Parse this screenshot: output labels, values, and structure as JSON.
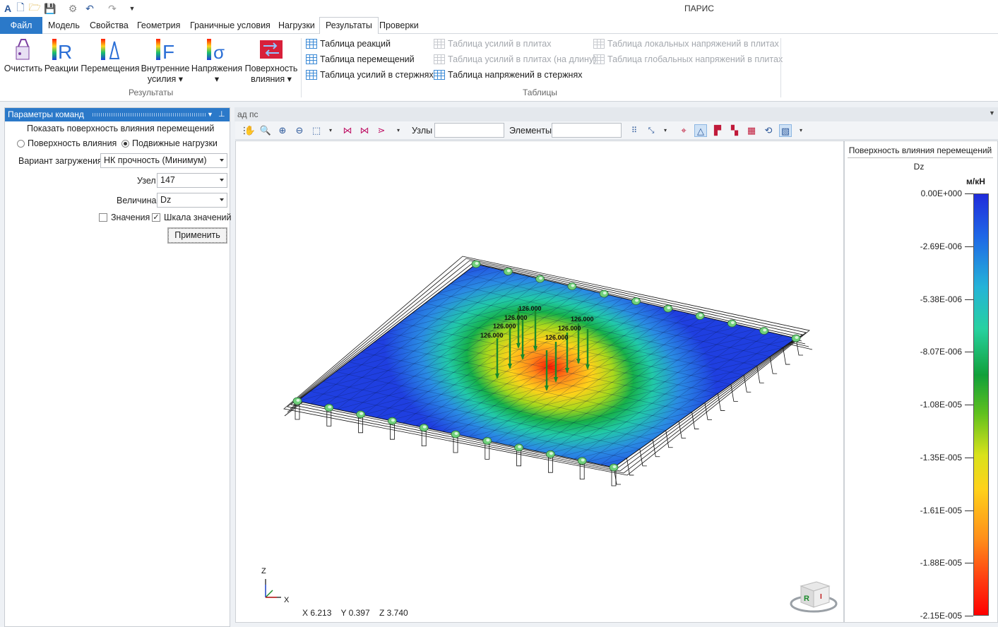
{
  "app": {
    "title": "ПАРИС"
  },
  "menu": {
    "tabs": [
      "Файл",
      "Модель",
      "Свойства",
      "Геометрия",
      "Граничные условия",
      "Нагрузки",
      "Результаты",
      "Проверки"
    ],
    "active": "Результаты"
  },
  "ribbon": {
    "results_group": {
      "label": "Результаты",
      "buttons": [
        {
          "label": "Очистить"
        },
        {
          "label": "Реакции"
        },
        {
          "label": "Перемещения"
        },
        {
          "label": "Внутренние",
          "label2": "усилия ▾"
        },
        {
          "label": "Напряжения",
          "label2": "▾"
        },
        {
          "label": "Поверхность",
          "label2": "влияния ▾"
        }
      ]
    },
    "tables_group": {
      "label": "Таблицы",
      "items": [
        {
          "label": "Таблица реакций",
          "enabled": true
        },
        {
          "label": "Таблица перемещений",
          "enabled": true
        },
        {
          "label": "Таблица усилий в стержнях",
          "enabled": true
        },
        {
          "label": "Таблица усилий в плитах",
          "enabled": false
        },
        {
          "label": "Таблица усилий в плитах (на длину)",
          "enabled": false
        },
        {
          "label": "Таблица напряжений в стержнях",
          "enabled": true
        },
        {
          "label": "Таблица локальных напряжений в плитах",
          "enabled": false
        },
        {
          "label": "Таблица глобальных напряжений в плитах",
          "enabled": false
        }
      ]
    }
  },
  "panel": {
    "title": "Параметры команд",
    "heading": "Показать поверхность влияния перемещений",
    "radio1": "Поверхность влияния",
    "radio2": "Подвижные нагрузки",
    "radio_selected": "Подвижные нагрузки",
    "variant_label": "Вариант загружения",
    "variant_value": "НК прочность (Минимум)",
    "node_label": "Узел",
    "node_value": "147",
    "quantity_label": "Величина",
    "quantity_value": "Dz",
    "values_label": "Значения",
    "values_checked": false,
    "scale_label": "Шкала значений",
    "scale_checked": true,
    "apply": "Применить"
  },
  "viewport": {
    "tab": "ад пс",
    "nodes_label": "Узлы",
    "elements_label": "Элементы",
    "load_labels": [
      "126.000",
      "126.000",
      "126.000",
      "126.000",
      "126.000",
      "126.000",
      "126.000"
    ],
    "axes": {
      "z": "Z",
      "x": "X"
    },
    "status": {
      "x": "X  6.213",
      "y": "Y  0.397",
      "z": "Z  3.740"
    }
  },
  "legend": {
    "title": "Поверхность влияния перемещений",
    "quantity": "Dz",
    "unit": "м/кН",
    "ticks": [
      "0.00E+000",
      "-2.69E-006",
      "-5.38E-006",
      "-8.07E-006",
      "-1.08E-005",
      "-1.35E-005",
      "-1.61E-005",
      "-1.88E-005",
      "-2.15E-005"
    ]
  },
  "colors": {
    "accent": "#2b79c9",
    "surface_low": "#1f3fe0",
    "surface_high": "#ff1a00"
  }
}
